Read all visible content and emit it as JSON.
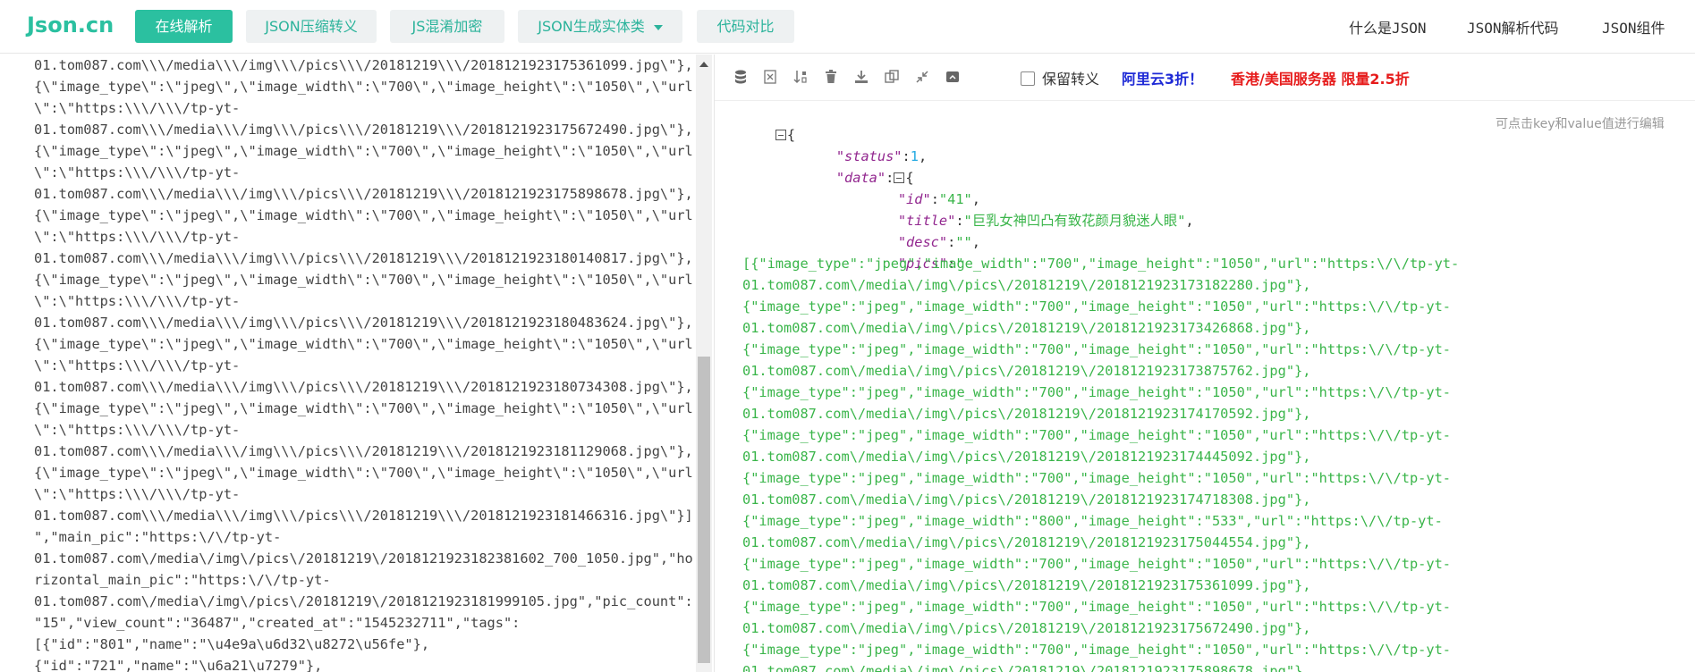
{
  "header": {
    "logo": "Json.cn",
    "nav": [
      {
        "label": "在线解析"
      },
      {
        "label": "JSON压缩转义"
      },
      {
        "label": "JS混淆加密"
      },
      {
        "label": "JSON生成实体类"
      },
      {
        "label": "代码对比"
      }
    ],
    "right_links": [
      {
        "label": "什么是JSON"
      },
      {
        "label": "JSON解析代码"
      },
      {
        "label": "JSON组件"
      }
    ]
  },
  "left": {
    "lines": [
      "01.tom087.com\\\\\\/media\\\\\\/img\\\\\\/pics\\\\\\/20181219\\\\\\/2018121923175361099.jpg\\\"},",
      "{\\\"image_type\\\":\\\"jpeg\\\",\\\"image_width\\\":\\\"700\\\",\\\"image_height\\\":\\\"1050\\\",\\\"url",
      "\\\":\\\"https:\\\\\\/\\\\\\/tp-yt-",
      "01.tom087.com\\\\\\/media\\\\\\/img\\\\\\/pics\\\\\\/20181219\\\\\\/2018121923175672490.jpg\\\"},",
      "{\\\"image_type\\\":\\\"jpeg\\\",\\\"image_width\\\":\\\"700\\\",\\\"image_height\\\":\\\"1050\\\",\\\"url",
      "\\\":\\\"https:\\\\\\/\\\\\\/tp-yt-",
      "01.tom087.com\\\\\\/media\\\\\\/img\\\\\\/pics\\\\\\/20181219\\\\\\/2018121923175898678.jpg\\\"},",
      "{\\\"image_type\\\":\\\"jpeg\\\",\\\"image_width\\\":\\\"700\\\",\\\"image_height\\\":\\\"1050\\\",\\\"url",
      "\\\":\\\"https:\\\\\\/\\\\\\/tp-yt-",
      "01.tom087.com\\\\\\/media\\\\\\/img\\\\\\/pics\\\\\\/20181219\\\\\\/2018121923180140817.jpg\\\"},",
      "{\\\"image_type\\\":\\\"jpeg\\\",\\\"image_width\\\":\\\"700\\\",\\\"image_height\\\":\\\"1050\\\",\\\"url",
      "\\\":\\\"https:\\\\\\/\\\\\\/tp-yt-",
      "01.tom087.com\\\\\\/media\\\\\\/img\\\\\\/pics\\\\\\/20181219\\\\\\/2018121923180483624.jpg\\\"},",
      "{\\\"image_type\\\":\\\"jpeg\\\",\\\"image_width\\\":\\\"700\\\",\\\"image_height\\\":\\\"1050\\\",\\\"url",
      "\\\":\\\"https:\\\\\\/\\\\\\/tp-yt-",
      "01.tom087.com\\\\\\/media\\\\\\/img\\\\\\/pics\\\\\\/20181219\\\\\\/2018121923180734308.jpg\\\"},",
      "{\\\"image_type\\\":\\\"jpeg\\\",\\\"image_width\\\":\\\"700\\\",\\\"image_height\\\":\\\"1050\\\",\\\"url",
      "\\\":\\\"https:\\\\\\/\\\\\\/tp-yt-",
      "01.tom087.com\\\\\\/media\\\\\\/img\\\\\\/pics\\\\\\/20181219\\\\\\/2018121923181129068.jpg\\\"},",
      "{\\\"image_type\\\":\\\"jpeg\\\",\\\"image_width\\\":\\\"700\\\",\\\"image_height\\\":\\\"1050\\\",\\\"url",
      "\\\":\\\"https:\\\\\\/\\\\\\/tp-yt-",
      "01.tom087.com\\\\\\/media\\\\\\/img\\\\\\/pics\\\\\\/20181219\\\\\\/2018121923181466316.jpg\\\"}]",
      "\",\"main_pic\":\"https:\\/\\/tp-yt-",
      "01.tom087.com\\/media\\/img\\/pics\\/20181219\\/2018121923182381602_700_1050.jpg\",\"ho",
      "rizontal_main_pic\":\"https:\\/\\/tp-yt-",
      "01.tom087.com\\/media\\/img\\/pics\\/20181219\\/2018121923181999105.jpg\",\"pic_count\":",
      "\"15\",\"view_count\":\"36487\",\"created_at\":\"1545232711\",\"tags\":",
      "[{\"id\":\"801\",\"name\":\"\\u4e9a\\u6d32\\u8272\\u56fe\"},",
      "{\"id\":\"721\",\"name\":\"\\u6a21\\u7279\"},"
    ]
  },
  "toolbar": {
    "icons": [
      "database-icon",
      "excel-icon",
      "sort-icon",
      "trash-icon",
      "download-icon",
      "copy-icon",
      "compress-icon",
      "share-icon"
    ],
    "keep_escape": "保留转义",
    "ad_aliyun": "阿里云3折！",
    "ad_server": "香港/美国服务器 限量2.5折",
    "hint": "可点击key和value值进行编辑"
  },
  "formatted": {
    "open_brace": "{",
    "status_key": "\"status\"",
    "status_value": "1",
    "data_key": "\"data\"",
    "id_key": "\"id\"",
    "id_value": "\"41\"",
    "title_key": "\"title\"",
    "title_value": "\"巨乳女神凹凸有致花颜月貌迷人眼\"",
    "desc_key": "\"desc\"",
    "desc_value": "\"\"",
    "pics_key": "\"pics\"",
    "pics_open": "\"",
    "pics_lines": [
      "[{\"image_type\":\"jpeg\",\"image_width\":\"700\",\"image_height\":\"1050\",\"url\":\"https:\\/\\/tp-yt-",
      "01.tom087.com\\/media\\/img\\/pics\\/20181219\\/2018121923173182280.jpg\"},",
      "{\"image_type\":\"jpeg\",\"image_width\":\"700\",\"image_height\":\"1050\",\"url\":\"https:\\/\\/tp-yt-",
      "01.tom087.com\\/media\\/img\\/pics\\/20181219\\/2018121923173426868.jpg\"},",
      "{\"image_type\":\"jpeg\",\"image_width\":\"700\",\"image_height\":\"1050\",\"url\":\"https:\\/\\/tp-yt-",
      "01.tom087.com\\/media\\/img\\/pics\\/20181219\\/2018121923173875762.jpg\"},",
      "{\"image_type\":\"jpeg\",\"image_width\":\"700\",\"image_height\":\"1050\",\"url\":\"https:\\/\\/tp-yt-",
      "01.tom087.com\\/media\\/img\\/pics\\/20181219\\/2018121923174170592.jpg\"},",
      "{\"image_type\":\"jpeg\",\"image_width\":\"700\",\"image_height\":\"1050\",\"url\":\"https:\\/\\/tp-yt-",
      "01.tom087.com\\/media\\/img\\/pics\\/20181219\\/2018121923174445092.jpg\"},",
      "{\"image_type\":\"jpeg\",\"image_width\":\"700\",\"image_height\":\"1050\",\"url\":\"https:\\/\\/tp-yt-",
      "01.tom087.com\\/media\\/img\\/pics\\/20181219\\/2018121923174718308.jpg\"},",
      "{\"image_type\":\"jpeg\",\"image_width\":\"800\",\"image_height\":\"533\",\"url\":\"https:\\/\\/tp-yt-",
      "01.tom087.com\\/media\\/img\\/pics\\/20181219\\/2018121923175044554.jpg\"},",
      "{\"image_type\":\"jpeg\",\"image_width\":\"700\",\"image_height\":\"1050\",\"url\":\"https:\\/\\/tp-yt-",
      "01.tom087.com\\/media\\/img\\/pics\\/20181219\\/2018121923175361099.jpg\"},",
      "{\"image_type\":\"jpeg\",\"image_width\":\"700\",\"image_height\":\"1050\",\"url\":\"https:\\/\\/tp-yt-",
      "01.tom087.com\\/media\\/img\\/pics\\/20181219\\/2018121923175672490.jpg\"},",
      "{\"image_type\":\"jpeg\",\"image_width\":\"700\",\"image_height\":\"1050\",\"url\":\"https:\\/\\/tp-yt-",
      "01.tom087.com\\/media\\/img\\/pics\\/20181219\\/2018121923175898678.jpg\"},"
    ]
  },
  "colors": {
    "brand": "#2bc0a0",
    "key": "#92278f",
    "number": "#25aae2",
    "string": "#3ab54a",
    "ad_blue": "#1e2ad6",
    "ad_red": "#e61b1b"
  }
}
